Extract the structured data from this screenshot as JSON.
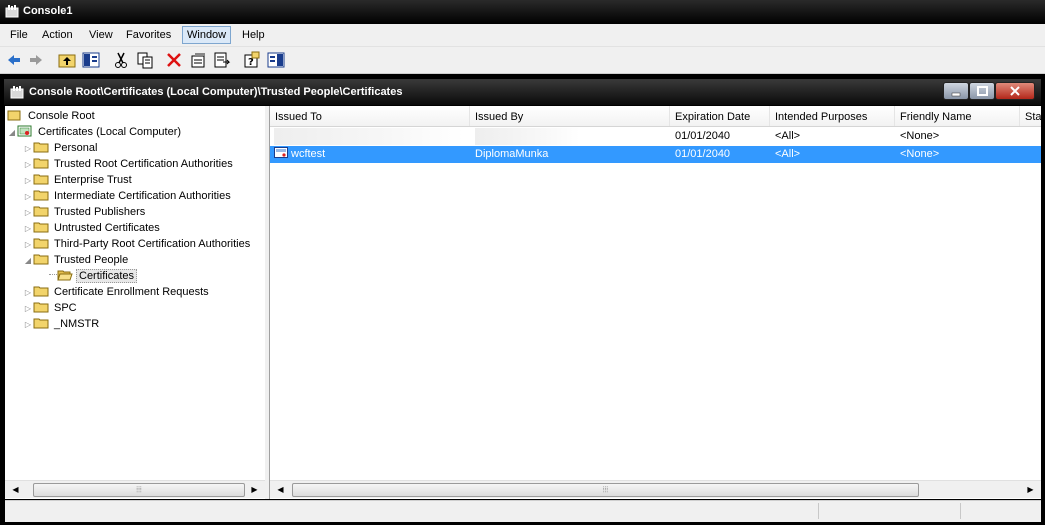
{
  "app": {
    "title": "Console1",
    "document_title": "Console Root\\Certificates (Local Computer)\\Trusted People\\Certificates"
  },
  "menu": [
    {
      "label": "File"
    },
    {
      "label": "Action"
    },
    {
      "label": "View"
    },
    {
      "label": "Favorites"
    },
    {
      "label": "Window"
    },
    {
      "label": "Help"
    }
  ],
  "toolbar": {
    "buttons": [
      "back-arrow-icon",
      "forward-arrow-icon",
      "up-folder-icon",
      "show-hide-tree-icon",
      "cut-icon",
      "copy-icon",
      "delete-icon",
      "properties-icon",
      "export-list-icon",
      "help-icon",
      "show-hide-action-pane-icon"
    ]
  },
  "tree": {
    "root": "Console Root",
    "certs": "Certificates (Local Computer)",
    "items": [
      {
        "label": "Personal"
      },
      {
        "label": "Trusted Root Certification Authorities"
      },
      {
        "label": "Enterprise Trust"
      },
      {
        "label": "Intermediate Certification Authorities"
      },
      {
        "label": "Trusted Publishers"
      },
      {
        "label": "Untrusted Certificates"
      },
      {
        "label": "Third-Party Root Certification Authorities"
      },
      {
        "label": "Trusted People"
      },
      {
        "label": "Certificates"
      },
      {
        "label": "Certificate Enrollment Requests"
      },
      {
        "label": "SPC"
      },
      {
        "label": "_NMSTR"
      }
    ]
  },
  "list": {
    "columns": [
      "Issued To",
      "Issued By",
      "Expiration Date",
      "Intended Purposes",
      "Friendly Name",
      "Sta"
    ],
    "rows": [
      {
        "issued_to": "",
        "issued_by": "",
        "expiration": "01/01/2040",
        "purposes": "<All>",
        "friendly": "<None>"
      },
      {
        "issued_to": "wcftest",
        "issued_by": "DiplomaMunka",
        "expiration": "01/01/2040",
        "purposes": "<All>",
        "friendly": "<None>"
      }
    ]
  },
  "colors": {
    "selection": "#3399ff",
    "titlebar": "#000000",
    "chrome": "#f0f0f0"
  }
}
